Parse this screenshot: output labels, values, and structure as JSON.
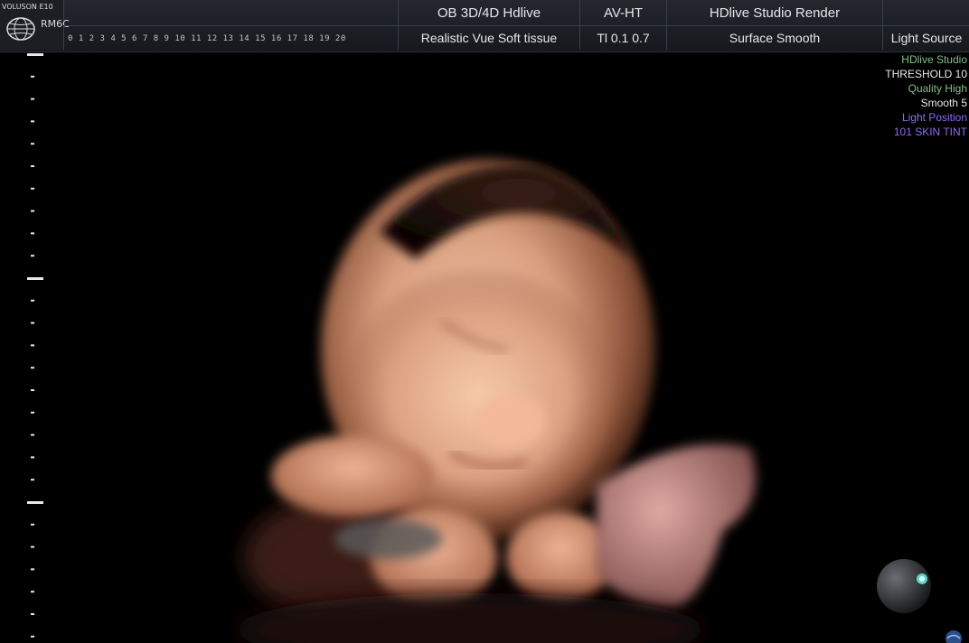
{
  "header": {
    "brand": "VOLUSON E10",
    "probe": "RM6C",
    "scale_markers": "0 1 2 3 4 5 6 7 8 9 10 11 12 13 14 15 16 17 18 19 20",
    "cells": [
      {
        "top": "OB 3D/4D Hdlive",
        "bottom": "Realistic Vue Soft tissue"
      },
      {
        "top": "AV-HT",
        "bottom": "Tl 0.1 0.7"
      },
      {
        "top": "HDlive Studio Render",
        "bottom": "Surface Smooth"
      },
      {
        "top": "",
        "bottom": "Light Source"
      }
    ]
  },
  "params": [
    {
      "text": "HDlive Studio",
      "tone": "green"
    },
    {
      "text": "THRESHOLD 10",
      "tone": "white"
    },
    {
      "text": "Quality High",
      "tone": "green"
    },
    {
      "text": "Smooth 5",
      "tone": "white"
    },
    {
      "text": "Light Position",
      "tone": "violet"
    },
    {
      "text": "101 SKIN TINT",
      "tone": "violet"
    }
  ],
  "colors": {
    "background": "#000000",
    "skin_tone": "#d9a58a",
    "accent_light": "#58d7c8"
  }
}
